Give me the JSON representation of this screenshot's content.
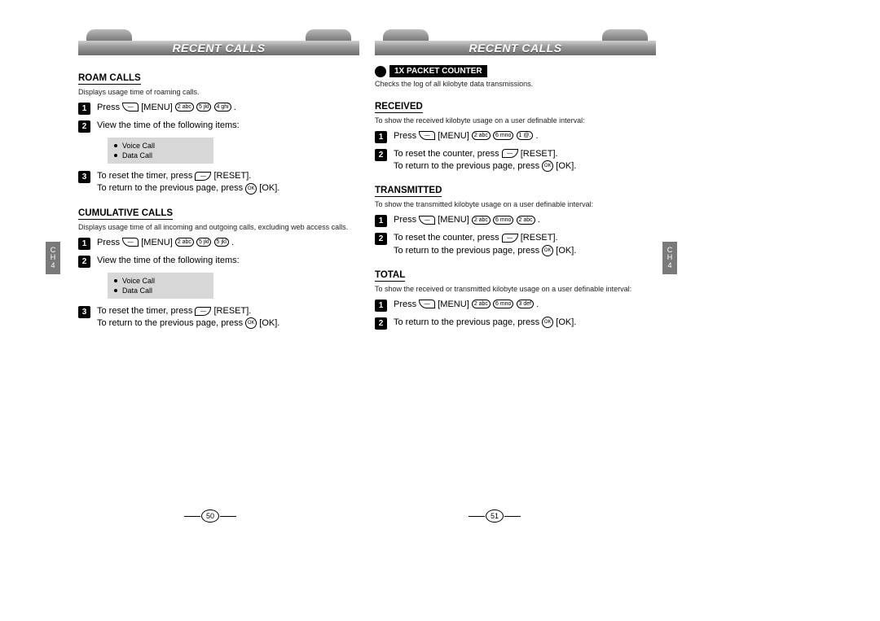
{
  "header": {
    "title": "RECENT CALLS"
  },
  "ch_tab": {
    "line1": "C",
    "line2": "H",
    "line3": "4"
  },
  "roam": {
    "heading": "ROAM CALLS",
    "desc": "Displays usage time of roaming calls.",
    "steps": [
      {
        "pre": "Press ",
        "keys": [
          "soft",
          "MENU",
          "2",
          "5",
          "4"
        ],
        "post": " ."
      },
      {
        "text": "View the time of the following items:"
      },
      {
        "pre": "To reset the timer, press ",
        "keys": [
          "softR",
          "RESET"
        ],
        "post": ".",
        "line2_pre": "To return to the previous page, press ",
        "line2_keys": [
          "OK",
          "OKLBL"
        ],
        "line2_post": "."
      }
    ],
    "box": [
      "Voice Call",
      "Data Call"
    ]
  },
  "cumulative": {
    "heading": "CUMULATIVE CALLS",
    "desc": "Displays usage time of all incoming and outgoing calls, excluding web access calls.",
    "steps": [
      {
        "pre": "Press ",
        "keys": [
          "soft",
          "MENU",
          "2",
          "5",
          "5"
        ],
        "post": " ."
      },
      {
        "text": "View the time of the following items:"
      },
      {
        "pre": "To reset the timer, press ",
        "keys": [
          "softR",
          "RESET"
        ],
        "post": ".",
        "line2_pre": "To return to the previous page, press ",
        "line2_keys": [
          "OK",
          "OKLBL"
        ],
        "line2_post": "."
      }
    ],
    "box": [
      "Voice Call",
      "Data Call"
    ]
  },
  "packet": {
    "pill": "1X PACKET COUNTER",
    "desc": "Checks the log of all kilobyte data transmissions."
  },
  "received": {
    "heading": "RECEIVED",
    "desc": "To show the received kilobyte usage on a user definable interval:",
    "steps": [
      {
        "pre": "Press ",
        "keys": [
          "soft",
          "MENU",
          "2",
          "6",
          "1"
        ],
        "post": " ."
      },
      {
        "pre": "To reset the counter, press ",
        "keys": [
          "softR",
          "RESET"
        ],
        "post": ".",
        "line2_pre": "To return to the previous page, press ",
        "line2_keys": [
          "OK",
          "OKLBL"
        ],
        "line2_post": "."
      }
    ]
  },
  "transmitted": {
    "heading": "TRANSMITTED",
    "desc": "To show the transmitted kilobyte usage on a user definable interval:",
    "steps": [
      {
        "pre": "Press ",
        "keys": [
          "soft",
          "MENU",
          "2",
          "6",
          "2"
        ],
        "post": " ."
      },
      {
        "pre": "To reset the counter, press ",
        "keys": [
          "softR",
          "RESET"
        ],
        "post": ".",
        "line2_pre": "To return to the previous page, press ",
        "line2_keys": [
          "OK",
          "OKLBL"
        ],
        "line2_post": "."
      }
    ]
  },
  "total": {
    "heading": "TOTAL",
    "desc": "To show the received or transmitted kilobyte usage on a user definable interval:",
    "steps": [
      {
        "pre": "Press ",
        "keys": [
          "soft",
          "MENU",
          "2",
          "6",
          "3"
        ],
        "post": " ."
      },
      {
        "pre": "To return to the previous page, press ",
        "keys": [
          "OK",
          "OKLBL"
        ],
        "post": "."
      }
    ]
  },
  "page_numbers": {
    "left": "50",
    "right": "51"
  },
  "labels": {
    "menu": "[MENU]",
    "reset": "[RESET].",
    "ok": "[OK]."
  }
}
